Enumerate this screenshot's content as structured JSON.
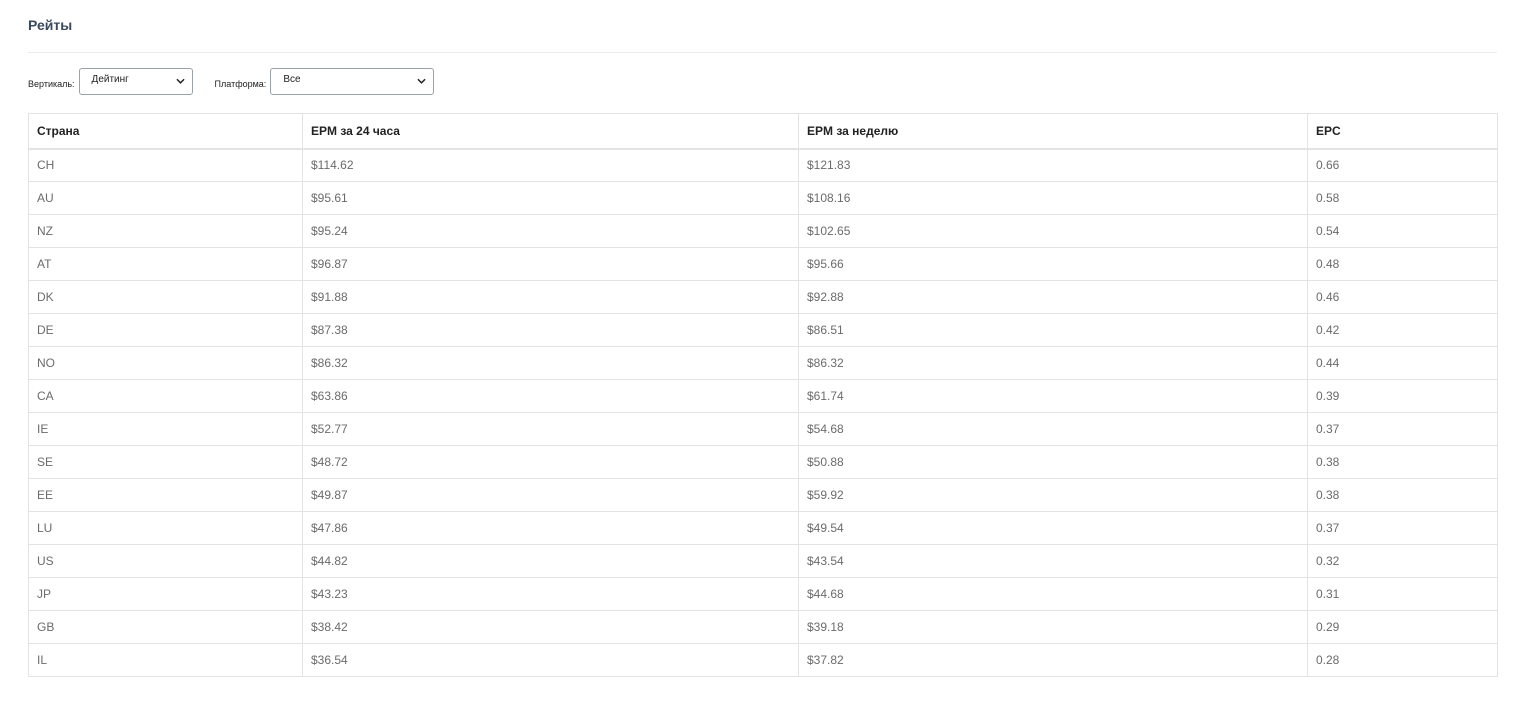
{
  "page": {
    "title": "Рейты"
  },
  "filters": {
    "vertical_label": "Вертикаль:",
    "vertical_value": "Дейтинг",
    "platform_label": "Платформа:",
    "platform_value": "Все"
  },
  "table": {
    "headers": [
      "Страна",
      "EPM за 24 часа",
      "EPM за неделю",
      "EPC"
    ],
    "rows": [
      [
        "CH",
        "$114.62",
        "$121.83",
        "0.66"
      ],
      [
        "AU",
        "$95.61",
        "$108.16",
        "0.58"
      ],
      [
        "NZ",
        "$95.24",
        "$102.65",
        "0.54"
      ],
      [
        "AT",
        "$96.87",
        "$95.66",
        "0.48"
      ],
      [
        "DK",
        "$91.88",
        "$92.88",
        "0.46"
      ],
      [
        "DE",
        "$87.38",
        "$86.51",
        "0.42"
      ],
      [
        "NO",
        "$86.32",
        "$86.32",
        "0.44"
      ],
      [
        "CA",
        "$63.86",
        "$61.74",
        "0.39"
      ],
      [
        "IE",
        "$52.77",
        "$54.68",
        "0.37"
      ],
      [
        "SE",
        "$48.72",
        "$50.88",
        "0.38"
      ],
      [
        "EE",
        "$49.87",
        "$59.92",
        "0.38"
      ],
      [
        "LU",
        "$47.86",
        "$49.54",
        "0.37"
      ],
      [
        "US",
        "$44.82",
        "$43.54",
        "0.32"
      ],
      [
        "JP",
        "$43.23",
        "$44.68",
        "0.31"
      ],
      [
        "GB",
        "$38.42",
        "$39.18",
        "0.29"
      ],
      [
        "IL",
        "$36.54",
        "$37.82",
        "0.28"
      ]
    ]
  },
  "icons": {
    "select_arrow": "chevron-down-icon"
  }
}
